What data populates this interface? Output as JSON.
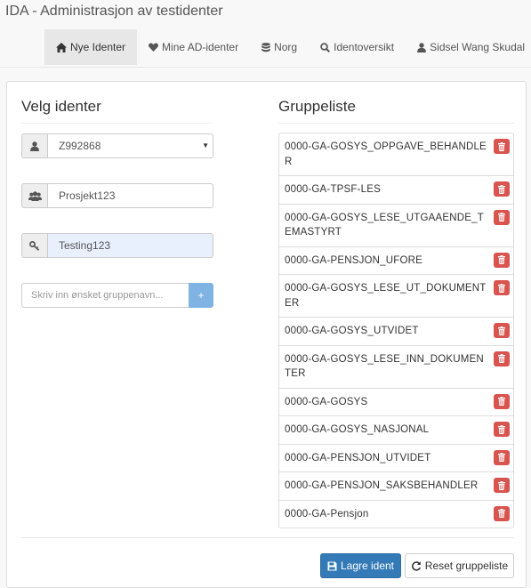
{
  "app": {
    "title": "IDA - Administrasjon av testidenter"
  },
  "nav": {
    "items": [
      {
        "label": "Nye Identer",
        "icon": "home-icon",
        "active": true
      },
      {
        "label": "Mine AD-identer",
        "icon": "heart-icon",
        "active": false
      },
      {
        "label": "Norg",
        "icon": "database-icon",
        "active": false
      },
      {
        "label": "Identoversikt",
        "icon": "search-icon",
        "active": false
      },
      {
        "label": "Sidsel Wang Skudal",
        "icon": "user-icon",
        "active": false,
        "dropdown": true
      }
    ]
  },
  "left": {
    "heading": "Velg identer",
    "ident_select": {
      "value": "Z992868",
      "icon": "user-icon"
    },
    "project_field": {
      "value": "Prosjekt123",
      "icon": "users-icon"
    },
    "password_field": {
      "value": "Testing123",
      "icon": "key-icon"
    },
    "group_input": {
      "placeholder": "Skriv inn ønsket gruppenavn...",
      "add_label": "+"
    }
  },
  "right": {
    "heading": "Gruppeliste",
    "groups": [
      "0000-GA-GOSYS_OPPGAVE_BEHANDLER",
      "0000-GA-TPSF-LES",
      "0000-GA-GOSYS_LESE_UTGAAENDE_TEMASTYRT",
      "0000-GA-PENSJON_UFORE",
      "0000-GA-GOSYS_LESE_UT_DOKUMENTER",
      "0000-GA-GOSYS_UTVIDET",
      "0000-GA-GOSYS_LESE_INN_DOKUMENTER",
      "0000-GA-GOSYS",
      "0000-GA-GOSYS_NASJONAL",
      "0000-GA-PENSJON_UTVIDET",
      "0000-GA-PENSJON_SAKSBEHANDLER",
      "0000-GA-Pensjon"
    ]
  },
  "actions": {
    "save_label": "Lagre ident",
    "reset_label": "Reset gruppeliste"
  },
  "colors": {
    "primary": "#337ab7",
    "danger": "#d9534f",
    "add_button": "#7fb3e3"
  }
}
